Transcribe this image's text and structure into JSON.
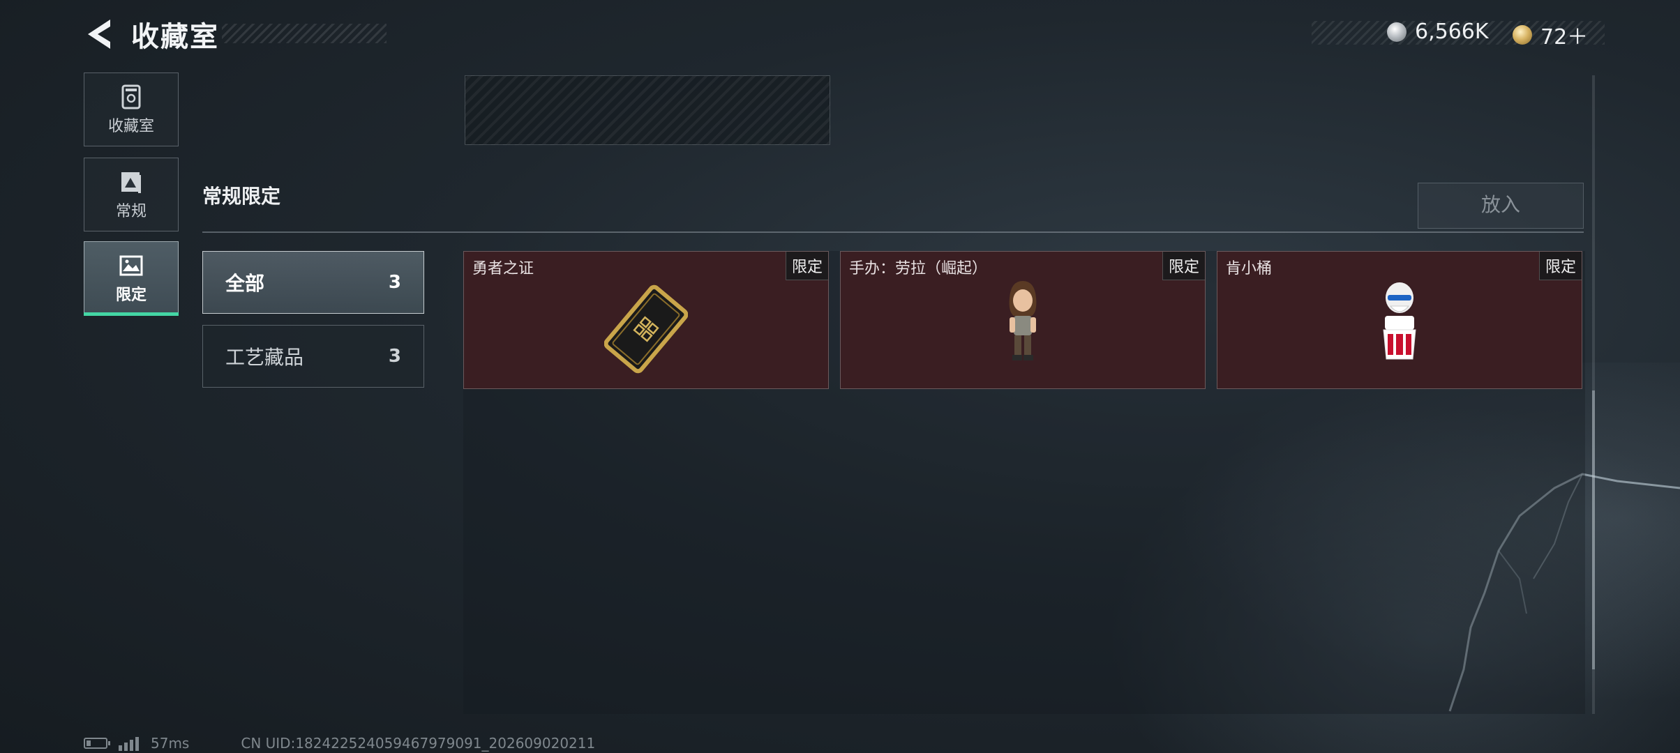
{
  "header": {
    "title": "收藏室",
    "currencies": [
      {
        "icon": "silver-coin-icon",
        "value": "6,566K"
      },
      {
        "icon": "gold-coin-icon",
        "value": "72＋"
      }
    ]
  },
  "sidebar": {
    "items": [
      {
        "label": "收藏室",
        "icon": "trophy-cabinet-icon",
        "active": false
      },
      {
        "label": "常规",
        "icon": "picture-frame-icon",
        "active": false
      },
      {
        "label": "限定",
        "icon": "landscape-image-icon",
        "active": true
      }
    ]
  },
  "main": {
    "section_title": "常规限定",
    "put_in_label": "放入",
    "filters": [
      {
        "label": "全部",
        "count": "3",
        "active": true
      },
      {
        "label": "工艺藏品",
        "count": "3",
        "active": false
      }
    ],
    "cards": [
      {
        "name": "勇者之证",
        "badge": "限定",
        "icon": "gold-card-icon"
      },
      {
        "name": "手办：劳拉（崛起）",
        "badge": "限定",
        "icon": "lara-figure-icon"
      },
      {
        "name": "肯小桶",
        "badge": "限定",
        "icon": "colonel-figure-icon"
      }
    ]
  },
  "status_bar": {
    "latency": "57ms",
    "uid": "CN UID:182422524059467979091_202609020211"
  },
  "colors": {
    "accent": "#44d6a4",
    "card_bg": "#3a1e22"
  }
}
